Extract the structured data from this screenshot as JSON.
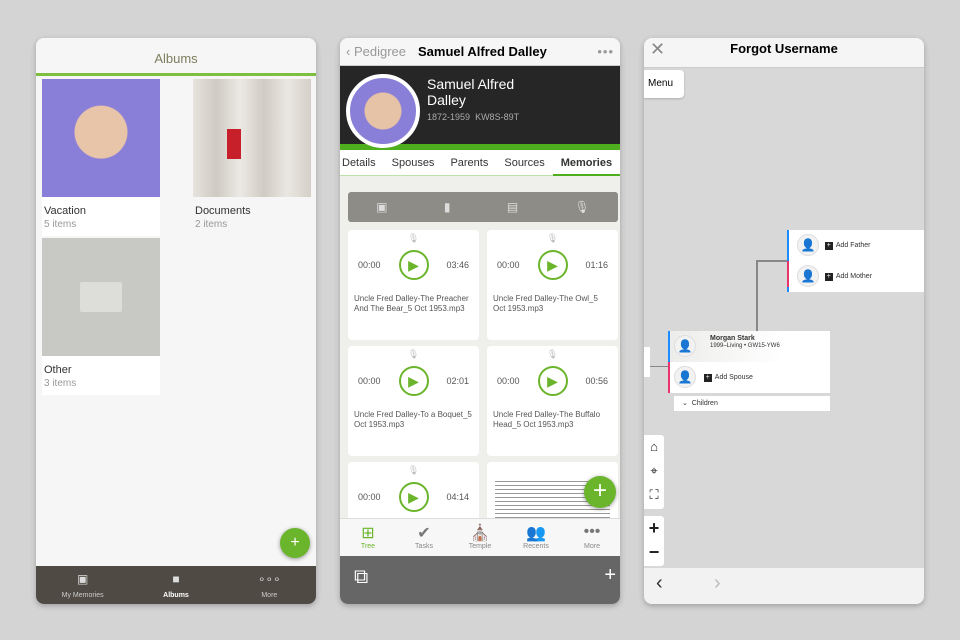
{
  "albums": {
    "title": "Albums",
    "items": [
      {
        "name": "Vacation",
        "count": "5 items"
      },
      {
        "name": "Documents",
        "count": "2 items"
      },
      {
        "name": "Other",
        "count": "3 items"
      }
    ],
    "tabs": [
      "My Memories",
      "Albums",
      "More"
    ]
  },
  "person": {
    "back": "Pedigree",
    "title": "Samuel Alfred Dalley",
    "name_line1": "Samuel Alfred",
    "name_line2": "Dalley",
    "dates": "1872-1959",
    "id": "KW8S-89T",
    "tabs": [
      "Details",
      "Spouses",
      "Parents",
      "Sources",
      "Memories"
    ],
    "memories": [
      {
        "start": "00:00",
        "end": "03:46",
        "name": "Uncle Fred Dalley-The Preacher And The Bear_5 Oct 1953.mp3"
      },
      {
        "start": "00:00",
        "end": "01:16",
        "name": "Uncle Fred Dalley-The Owl_5 Oct 1953.mp3"
      },
      {
        "start": "00:00",
        "end": "02:01",
        "name": "Uncle Fred Dalley-To a Boquet_5 Oct 1953.mp3"
      },
      {
        "start": "00:00",
        "end": "00:56",
        "name": "Uncle Fred Dalley-The Buffalo Head_5 Oct 1953.mp3"
      },
      {
        "start": "00:00",
        "end": "04:14",
        "name": ""
      }
    ],
    "bottom_tabs": [
      "Tree",
      "Tasks",
      "Temple",
      "Recents",
      "More"
    ]
  },
  "tree": {
    "title": "Forgot Username",
    "menu": "Menu",
    "add_father": "Add Father",
    "add_mother": "Add Mother",
    "person_name": "Morgan Stark",
    "person_info": "1999–Living • GW15-YW6",
    "add_spouse": "Add Spouse",
    "children": "Children"
  },
  "colors": {
    "accent": "#6bb52c",
    "male": "#1a8cff",
    "female": "#e8336d"
  }
}
